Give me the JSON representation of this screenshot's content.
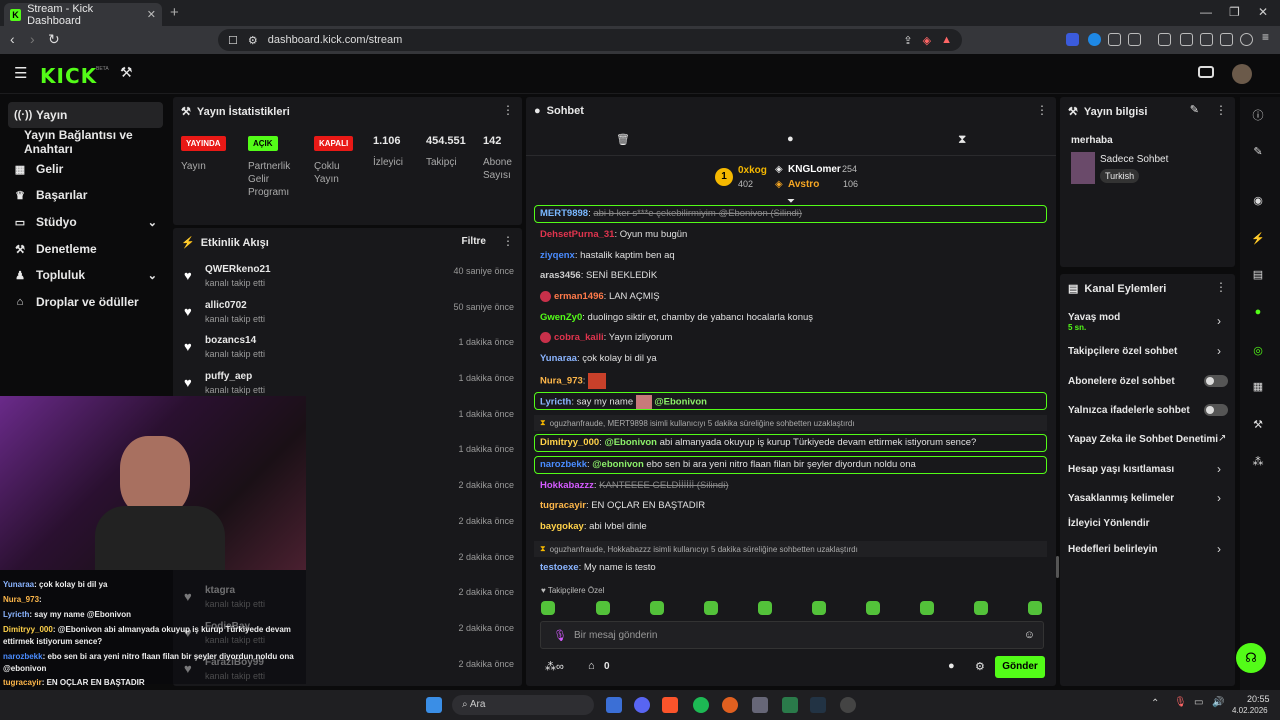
{
  "browser": {
    "tab_title": "Stream - Kick Dashboard",
    "url": "dashboard.kick.com/stream"
  },
  "header": {
    "logo": "KICK",
    "beta": "BETA"
  },
  "sidebar": {
    "items": [
      {
        "label": "Yayın",
        "icon": "broadcast-icon"
      },
      {
        "label": "Yayın Bağlantısı ve Anahtarı",
        "icon": ""
      },
      {
        "label": "Gelir",
        "icon": "revenue-icon"
      },
      {
        "label": "Başarılar",
        "icon": "trophy-icon"
      },
      {
        "label": "Stüdyo",
        "icon": "studio-icon"
      },
      {
        "label": "Denetleme",
        "icon": "hammer-icon"
      },
      {
        "label": "Topluluk",
        "icon": "community-icon"
      },
      {
        "label": "Droplar ve ödüller",
        "icon": "gift-icon"
      }
    ]
  },
  "stats": {
    "title": "Yayın İstatistikleri",
    "badges": [
      {
        "text": "YAYINDA",
        "label": "Yayın",
        "color": "#e91916"
      },
      {
        "text": "AÇIK",
        "label": "Partnerlik Gelir Programı",
        "color": "#53fc18"
      },
      {
        "text": "KAPALI",
        "label": "Çoklu Yayın",
        "color": "#e91916"
      }
    ],
    "numbers": [
      {
        "value": "1.106",
        "label": "İzleyici"
      },
      {
        "value": "454.551",
        "label": "Takipçi"
      },
      {
        "value": "142",
        "label": "Abone Sayısı"
      }
    ]
  },
  "activity": {
    "title": "Etkinlik Akışı",
    "filter": "Filtre",
    "events": [
      {
        "user": "QWERkeno21",
        "action": "kanalı takip etti",
        "ago": "40 saniye önce"
      },
      {
        "user": "allic0702",
        "action": "kanalı takip etti",
        "ago": "50 saniye önce"
      },
      {
        "user": "bozancs14",
        "action": "kanalı takip etti",
        "ago": "1 dakika önce"
      },
      {
        "user": "puffy_aep",
        "action": "kanalı takip etti",
        "ago": "1 dakika önce"
      },
      {
        "user": "",
        "action": "",
        "ago": "1 dakika önce"
      },
      {
        "user": "",
        "action": "",
        "ago": "1 dakika önce"
      },
      {
        "user": "",
        "action": "",
        "ago": "2 dakika önce"
      },
      {
        "user": "",
        "action": "",
        "ago": "2 dakika önce"
      },
      {
        "user": "",
        "action": "",
        "ago": "2 dakika önce"
      },
      {
        "user": "ktagra",
        "action": "kanalı takip etti",
        "ago": "2 dakika önce"
      },
      {
        "user": "FodieBay",
        "action": "kanalı takip etti",
        "ago": "2 dakika önce"
      },
      {
        "user": "FaraziBoy99",
        "action": "kanalı takip etti",
        "ago": "2 dakika önce"
      }
    ]
  },
  "chat": {
    "title": "Sohbet",
    "leaders": [
      {
        "rank": "1",
        "name": "0xkog",
        "amount": "402"
      },
      {
        "name": "KNGLomer",
        "amount": "254"
      },
      {
        "name": "Avstro",
        "amount": "106"
      }
    ],
    "messages": [
      {
        "user": "MERT9898",
        "text": "abi b ker s***e çekebilirmiyim @Ebonivon (Silindi)",
        "color": "#7ab8ff"
      },
      {
        "user": "DehsetPurna_31",
        "text": "Oyun mu bugün",
        "color": "#e0344e"
      },
      {
        "user": "ziyqenx",
        "text": "hastalik kaptim ben aq",
        "color": "#4a8cff"
      },
      {
        "user": "aras3456",
        "text": "SENİ BEKLEDİK",
        "color": "#cccccc"
      },
      {
        "user": "erman1496",
        "text": "LAN AÇMIŞ",
        "color": "#ff7a4a"
      },
      {
        "user": "GwenZy0",
        "text": "duolingo siktir et, chamby de yabancı hocalarla konuş",
        "color": "#53fc18"
      },
      {
        "user": "cobra_kaili",
        "text": "Yayın izliyorum",
        "color": "#e0344e"
      },
      {
        "user": "Yunaraa",
        "text": "çok kolay bi dil ya",
        "color": "#8ab4ff"
      },
      {
        "user": "Nura_973",
        "text": "",
        "color": "#ffb84a"
      },
      {
        "user": "Lyricth",
        "text": "say my name",
        "mention": "@Ebonivon",
        "color": "#8ab4ff"
      },
      {
        "system": "oguzhanfraude, MERT9898 isimli kullanıcıyı 5 dakika süreliğine sohbetten uzaklaştırdı"
      },
      {
        "user": "Dimitryy_000",
        "text": "abi almanyada okuyup iş kurup Türkiyede devam ettirmek istiyorum sence?",
        "mention": "@Ebonivon",
        "color": "#ffd24a"
      },
      {
        "user": "narozbekk",
        "text": "ebo sen bi ara yeni nitro flaan filan bir şeyler diyordun noldu ona",
        "mention": "@ebonivon",
        "color": "#4a8cff"
      },
      {
        "user": "Hokkabazzz",
        "text": "KANTEEEE GELDİİİİİİ (Silindi)",
        "color": "#d45bff"
      },
      {
        "user": "tugracayir",
        "text": "EN OÇLAR EN BAŞTADIR",
        "color": "#ffb84a"
      },
      {
        "user": "baygokay",
        "text": "abi lvbel dinle",
        "color": "#ffd24a"
      },
      {
        "system": "oguzhanfraude, Hokkabazzz isimli kullanıcıyı 5 dakika süreliğine sohbetten uzaklaştırdı"
      },
      {
        "user": "testoexe",
        "text": "My name is testo",
        "color": "#8ab4ff"
      }
    ],
    "followers_only": "Takipçilere Özel",
    "placeholder": "Bir mesaj gönderin",
    "count": "0",
    "send": "Gönder"
  },
  "info": {
    "title": "Yayın bilgisi",
    "stream_title": "merhaba",
    "category": "Sadece Sohbet",
    "tag": "Turkish"
  },
  "actions": {
    "title": "Kanal Eylemleri",
    "items": [
      {
        "label": "Yavaş mod",
        "sub": "5 sn."
      },
      {
        "label": "Takipçilere özel sohbet"
      },
      {
        "label": "Abonelere özel sohbet"
      },
      {
        "label": "Yalnızca ifadelerle sohbet"
      },
      {
        "label": "Yapay Zeka ile Sohbet Denetimi"
      },
      {
        "label": "Hesap yaşı kısıtlaması"
      },
      {
        "label": "Yasaklanmış kelimeler"
      },
      {
        "label": "İzleyici Yönlendir"
      },
      {
        "label": "Hedefleri belirleyin"
      }
    ]
  },
  "overlay": {
    "lines": [
      {
        "user": "Yunaraa",
        "text": ": çok kolay bi dil ya"
      },
      {
        "user": "Nura_973",
        "text": ":"
      },
      {
        "user": "Lyricth",
        "text": ": say my name @Ebonivon"
      },
      {
        "user": "Dimitryy_000",
        "text": ": @Ebonivon abi almanyada okuyup iş kurup Türkiyede devam"
      },
      {
        "user": "",
        "text": "ettirmek istiyorum sence?"
      },
      {
        "user": "narozbekk",
        "text": ": ebo sen bi ara yeni nitro flaan filan bir şeyler diyordun noldu ona"
      },
      {
        "user": "",
        "text": "@ebonivon"
      },
      {
        "user": "tugracayir",
        "text": ": EN OÇLAR EN BAŞTADIR"
      },
      {
        "user": "baygokay",
        "text": ": abi lvbel dinle"
      }
    ]
  },
  "taskbar": {
    "search": "Ara",
    "time": "20:55",
    "date": "4.02.2026"
  }
}
